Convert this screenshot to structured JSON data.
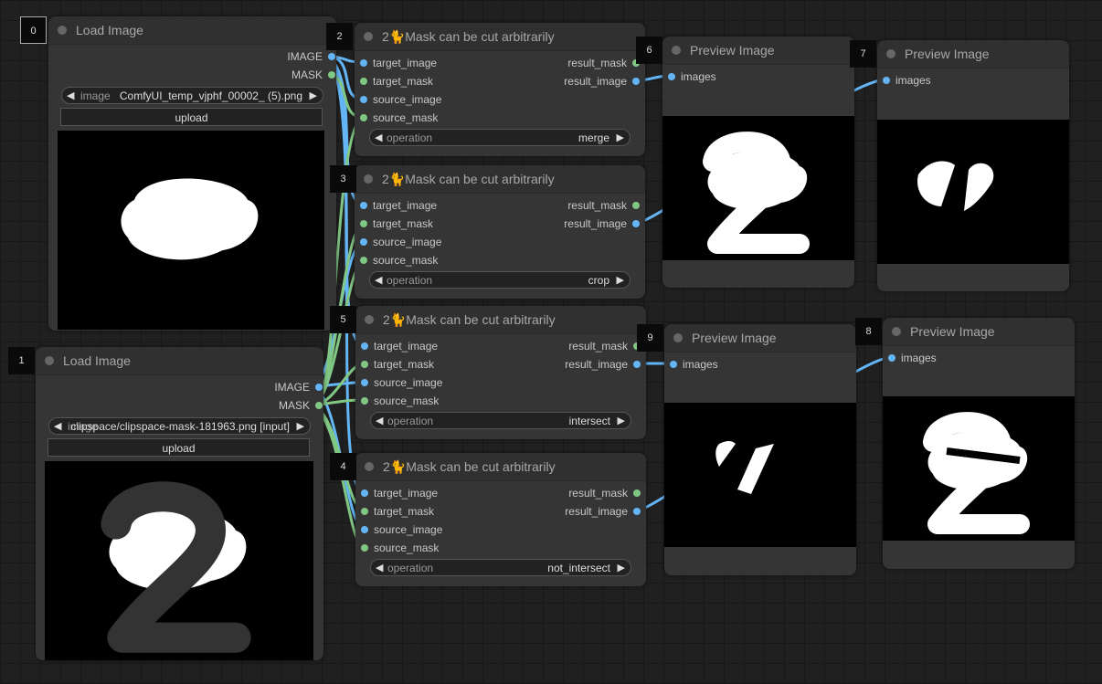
{
  "colors": {
    "image": "#64b5f6",
    "mask": "#81c784",
    "background": "#202020",
    "node": "#353535"
  },
  "load_nodes": [
    {
      "id": "0",
      "title": "Load Image",
      "outputs": [
        "IMAGE",
        "MASK"
      ],
      "image_label": "image",
      "image_value": "ComfyUI_temp_vjphf_00002_ (5).png",
      "upload": "upload"
    },
    {
      "id": "1",
      "title": "Load Image",
      "outputs": [
        "IMAGE",
        "MASK"
      ],
      "image_label": "image",
      "image_value": "clipspace/clipspace-mask-181963.png [input]",
      "upload": "upload"
    }
  ],
  "mask_nodes": [
    {
      "id": "2",
      "title": "2🐈Mask can be cut arbitrarily",
      "inputs": [
        "target_image",
        "target_mask",
        "source_image",
        "source_mask"
      ],
      "outputs": [
        "result_mask",
        "result_image"
      ],
      "operation_label": "operation",
      "operation": "merge"
    },
    {
      "id": "3",
      "title": "2🐈Mask can be cut arbitrarily",
      "inputs": [
        "target_image",
        "target_mask",
        "source_image",
        "source_mask"
      ],
      "outputs": [
        "result_mask",
        "result_image"
      ],
      "operation_label": "operation",
      "operation": "crop"
    },
    {
      "id": "5",
      "title": "2🐈Mask can be cut arbitrarily",
      "inputs": [
        "target_image",
        "target_mask",
        "source_image",
        "source_mask"
      ],
      "outputs": [
        "result_mask",
        "result_image"
      ],
      "operation_label": "operation",
      "operation": "intersect"
    },
    {
      "id": "4",
      "title": "2🐈Mask can be cut arbitrarily",
      "inputs": [
        "target_image",
        "target_mask",
        "source_image",
        "source_mask"
      ],
      "outputs": [
        "result_mask",
        "result_image"
      ],
      "operation_label": "operation",
      "operation": "not_intersect"
    }
  ],
  "preview_nodes": [
    {
      "id": "6",
      "title": "Preview Image",
      "input": "images"
    },
    {
      "id": "7",
      "title": "Preview Image",
      "input": "images"
    },
    {
      "id": "9",
      "title": "Preview Image",
      "input": "images"
    },
    {
      "id": "8",
      "title": "Preview Image",
      "input": "images"
    }
  ]
}
